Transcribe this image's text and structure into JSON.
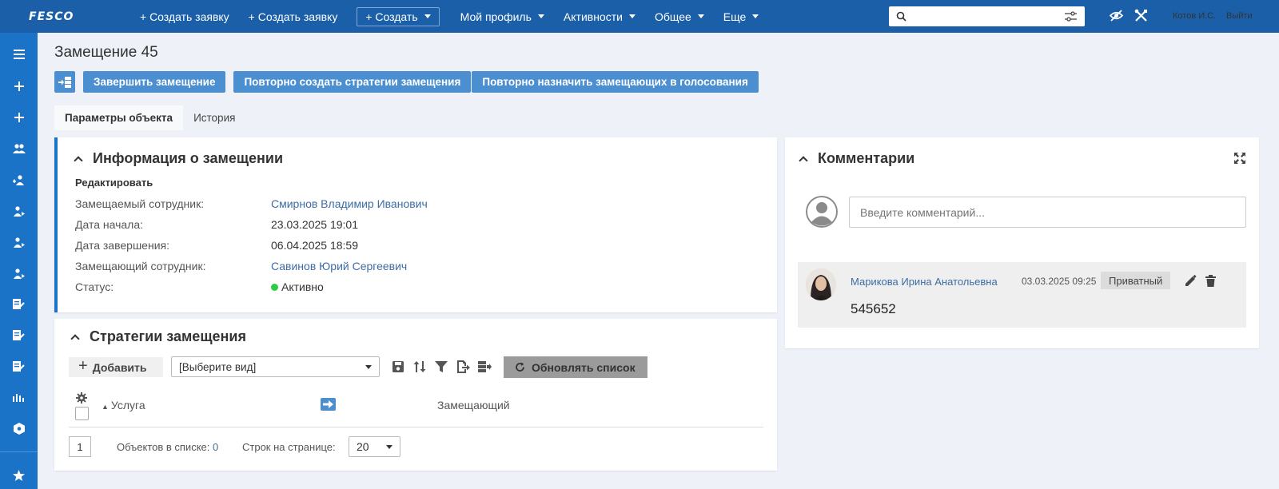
{
  "topbar": {
    "logo": "FESCO",
    "nav": [
      {
        "label": "+ Создать заявку"
      },
      {
        "label": "+ Создать заявку"
      },
      {
        "label": "+  Создать"
      },
      {
        "label": "Мой профиль"
      },
      {
        "label": "Активности"
      },
      {
        "label": "Общее"
      },
      {
        "label": "Еще"
      }
    ],
    "search_value": "",
    "user": "Котов И.С.",
    "logout": "Выйти"
  },
  "page": {
    "title": "Замещение 45",
    "actions": {
      "finish": "Завершить замещение",
      "recreate": "Повторно создать стратегии замещения",
      "reassign": "Повторно назначить замещающих в голосования"
    },
    "tabs": [
      "Параметры объекта",
      "История"
    ]
  },
  "info": {
    "title": "Информация о замещении",
    "edit": "Редактировать",
    "fields": [
      {
        "label": "Замещаемый сотрудник:",
        "value": "Смирнов Владимир Иванович"
      },
      {
        "label": "Дата начала:",
        "value": "23.03.2025 19:01"
      },
      {
        "label": "Дата завершения:",
        "value": "06.04.2025 18:59"
      },
      {
        "label": "Замещающий сотрудник:",
        "value": "Савинов Юрий Сергеевич"
      },
      {
        "label": "Статус:",
        "value": "Активно"
      }
    ],
    "status_color": "#2ecc40"
  },
  "strategies": {
    "title": "Стратегии замещения",
    "add": "Добавить",
    "view_select": "[Выберите вид]",
    "refresh": "Обновлять список",
    "columns": [
      "Услуга",
      "Замещающий"
    ],
    "page_number": "1",
    "objects_label": "Объектов в списке:",
    "objects_count": "0",
    "rows_label": "Строк на странице:",
    "rows_value": "20"
  },
  "comments": {
    "title": "Комментарии",
    "placeholder": "Введите комментарий...",
    "items": [
      {
        "author": "Марикова Ирина Анатольевна",
        "date": "03.03.2025 09:25",
        "badge": "Приватный",
        "text": "545652"
      }
    ]
  },
  "colors": {
    "topbar": "#1b5fa8",
    "sidebar": "#1b73c8",
    "button": "#4b8fd1",
    "link": "#3d6da3"
  }
}
